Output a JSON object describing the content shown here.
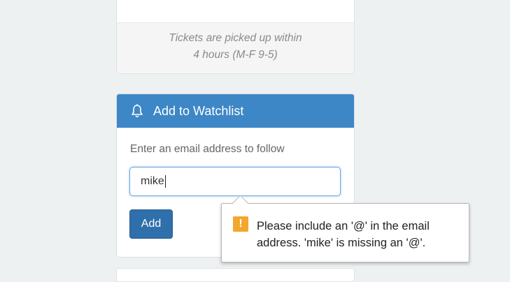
{
  "pickup_card": {
    "note_line1": "Tickets are picked up within",
    "note_line2": "4 hours (M-F 9-5)"
  },
  "watchlist": {
    "title": "Add to Watchlist",
    "icon": "bell-icon",
    "label": "Enter an email address to follow",
    "email_value": "mike",
    "add_label": "Add",
    "header_color": "#3d87c7",
    "button_color": "#2f6fab"
  },
  "validation_tooltip": {
    "icon": "warning-icon",
    "icon_glyph": "!",
    "icon_color": "#f3a72d",
    "message": "Please include an '@' in the email address. 'mike' is missing an '@'."
  }
}
